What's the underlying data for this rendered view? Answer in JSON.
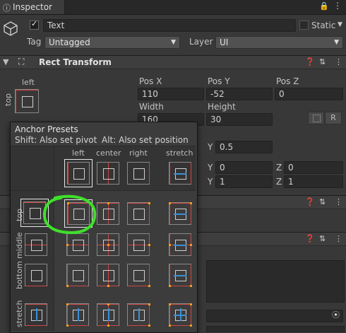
{
  "tab": {
    "title": "Inspector"
  },
  "object": {
    "name": "Text",
    "static_label": "Static",
    "tag_label": "Tag",
    "tag_value": "Untagged",
    "layer_label": "Layer",
    "layer_value": "UI"
  },
  "rect_transform": {
    "title": "Rect Transform",
    "anchor_h": "left",
    "anchor_v": "top",
    "pos_x_label": "Pos X",
    "pos_x": "110",
    "pos_y_label": "Pos Y",
    "pos_y": "-52",
    "pos_z_label": "Pos Z",
    "pos_z": "0",
    "width_label": "Width",
    "width": "160",
    "height_label": "Height",
    "height": "30",
    "r_button": "R"
  },
  "hidden_rows": {
    "pivot_y_label": "Y",
    "pivot_y": "0.5",
    "rot_y_label": "Y",
    "rot_y": "0",
    "rot_z_label": "Z",
    "rot_z": "0",
    "scale_y_label": "Y",
    "scale_y": "1",
    "scale_z_label": "Z",
    "scale_z": "1"
  },
  "popup": {
    "title": "Anchor Presets",
    "shift_hint": "Shift: Also set pivot",
    "alt_hint": "Alt: Also set position",
    "col_left": "left",
    "col_center": "center",
    "col_right": "right",
    "col_stretch": "stretch",
    "row_top": "top",
    "row_middle": "middle",
    "row_bottom": "bottom",
    "row_stretch": "stretch"
  },
  "colors": {
    "anchor_line": "#d04545",
    "pivot_dot": "#f0a020",
    "stretch_arrow": "#3a8fd8",
    "annotation": "#3ee02a"
  }
}
